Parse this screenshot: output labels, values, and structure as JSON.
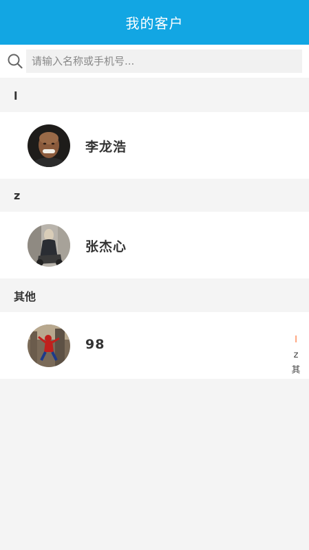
{
  "header": {
    "title": "我的客户"
  },
  "search": {
    "placeholder": "请输入名称或手机号...",
    "icon": "search-icon"
  },
  "sections": [
    {
      "letter": "l",
      "contacts": [
        {
          "name": "李龙浩",
          "avatar": "avatar-man-portrait"
        }
      ]
    },
    {
      "letter": "z",
      "contacts": [
        {
          "name": "张杰心",
          "avatar": "avatar-woman-motorcycle"
        }
      ]
    },
    {
      "letter": "其他",
      "contacts": [
        {
          "name": "98",
          "avatar": "avatar-spiderman"
        }
      ]
    }
  ],
  "index_bar": {
    "letters": [
      "l",
      "z",
      "其"
    ],
    "active": "l"
  },
  "colors": {
    "header": "#12a6e3",
    "index_active": "#ff6a2a",
    "background": "#f4f4f4"
  }
}
